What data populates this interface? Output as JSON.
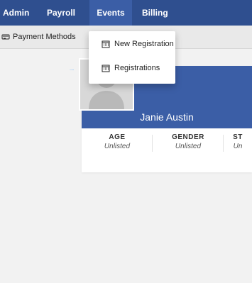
{
  "topnav": {
    "items": [
      {
        "label": "Admin"
      },
      {
        "label": "Payroll"
      },
      {
        "label": "Events"
      },
      {
        "label": "Billing"
      }
    ],
    "active_index": 2
  },
  "subnav": {
    "items": [
      {
        "label": "Payment Methods",
        "icon": "payment-methods-icon"
      }
    ]
  },
  "dropdown": {
    "items": [
      {
        "label": "New Registration",
        "icon": "calendar-icon"
      },
      {
        "label": "Registrations",
        "icon": "calendar-icon"
      }
    ]
  },
  "profile": {
    "name": "Janie Austin",
    "stats": [
      {
        "label": "AGE",
        "value": "Unlisted"
      },
      {
        "label": "GENDER",
        "value": "Unlisted"
      },
      {
        "label": "ST",
        "value": "Un"
      }
    ]
  },
  "colors": {
    "nav": "#2f4f8f",
    "nav_active": "#3b5ea6",
    "banner": "#3b5ea6",
    "arrow": "#1e90ff"
  }
}
